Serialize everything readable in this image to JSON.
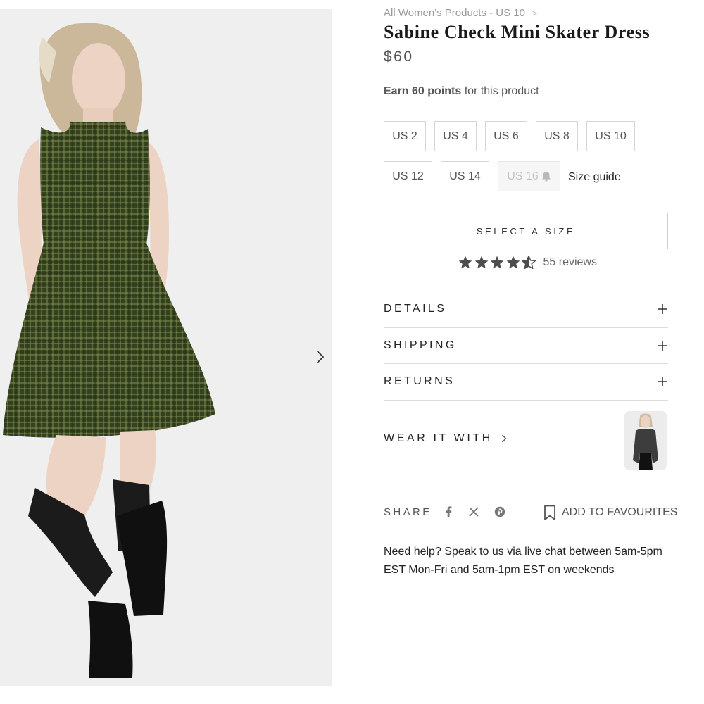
{
  "breadcrumb": {
    "text": "All Women's Products - US 10",
    "separator": ">"
  },
  "product": {
    "title": "Sabine Check Mini Skater Dress",
    "price": "$60",
    "points_prefix": "Earn",
    "points_bold": "60 points",
    "points_suffix": "for this product"
  },
  "sizes": [
    {
      "label": "US 2",
      "available": true
    },
    {
      "label": "US 4",
      "available": true
    },
    {
      "label": "US 6",
      "available": true
    },
    {
      "label": "US 8",
      "available": true
    },
    {
      "label": "US 10",
      "available": true
    },
    {
      "label": "US 12",
      "available": true
    },
    {
      "label": "US 14",
      "available": true
    },
    {
      "label": "US 16",
      "available": false
    }
  ],
  "size_guide_label": "Size guide",
  "select_size_label": "SELECT A SIZE",
  "rating": {
    "stars": 4.5,
    "max": 5,
    "reviews_label": "55 reviews"
  },
  "accordion": [
    {
      "label": "DETAILS"
    },
    {
      "label": "SHIPPING"
    },
    {
      "label": "RETURNS"
    }
  ],
  "wear_it_with_label": "WEAR IT WITH",
  "share_label": "SHARE",
  "social_icons": [
    "facebook-icon",
    "x-icon",
    "pinterest-icon"
  ],
  "favourites_label": "ADD TO FAVOURITES",
  "help_text": "Need help? Speak to us via live chat between 5am-5pm EST Mon-Fri and 5am-1pm EST on weekends",
  "colors": {
    "dress": "#3b4a27",
    "check_line": "#8e9a5a",
    "star": "#4d4d4d",
    "text_muted": "#555555",
    "border": "#dcdcdc"
  }
}
